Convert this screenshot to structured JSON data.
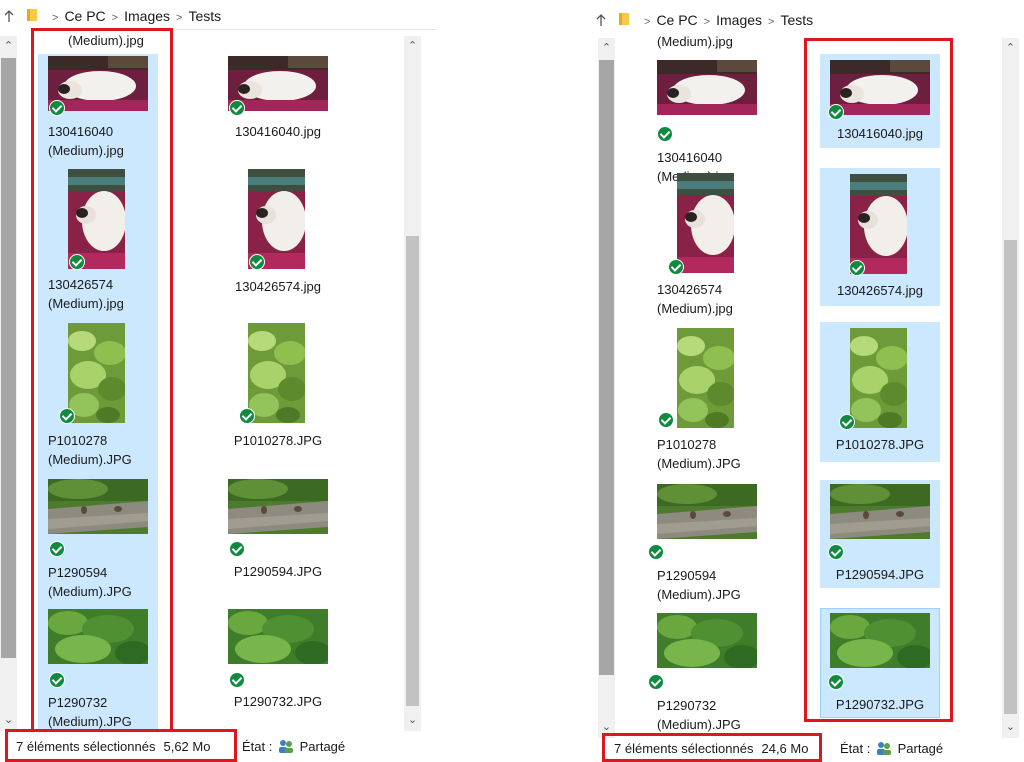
{
  "breadcrumb": [
    "Ce PC",
    "Images",
    "Tests"
  ],
  "colors": {
    "highlight": "#e0161e",
    "selection": "#cce8ff",
    "check": "#0f8a3e"
  },
  "icons": {
    "up": "up-arrow-icon",
    "folder": "folder-icon",
    "check": "check-badge-icon",
    "shared": "shared-users-icon"
  },
  "left": {
    "clipped_label": "(Medium).jpg",
    "medium_files": [
      {
        "line1": "130416040",
        "line2": "(Medium).jpg"
      },
      {
        "line1": "130426574",
        "line2": "(Medium).jpg"
      },
      {
        "line1": "P1010278",
        "line2": "(Medium).JPG"
      },
      {
        "line1": "P1290594",
        "line2": "(Medium).JPG"
      },
      {
        "line1": "P1290732",
        "line2": "(Medium).JPG"
      }
    ],
    "original_files": [
      "130416040.jpg",
      "130426574.jpg",
      "P1010278.JPG",
      "P1290594.JPG",
      "P1290732.JPG"
    ],
    "status": {
      "count_text": "7 éléments sélectionnés",
      "size_text": "5,62 Mo"
    }
  },
  "right": {
    "clipped_label": "(Medium).jpg",
    "medium_files": [
      {
        "line1": "130416040",
        "line2": "(Medium).jpg"
      },
      {
        "line1": "130426574",
        "line2": "(Medium).jpg"
      },
      {
        "line1": "P1010278",
        "line2": "(Medium).JPG"
      },
      {
        "line1": "P1290594",
        "line2": "(Medium).JPG"
      },
      {
        "line1": "P1290732",
        "line2": "(Medium).JPG"
      }
    ],
    "original_files": [
      "130416040.jpg",
      "130426574.jpg",
      "P1010278.JPG",
      "P1290594.JPG",
      "P1290732.JPG"
    ],
    "status": {
      "count_text": "7 éléments sélectionnés",
      "size_text": "24,6 Mo"
    }
  },
  "state": {
    "label": "État :",
    "value": "Partagé"
  }
}
